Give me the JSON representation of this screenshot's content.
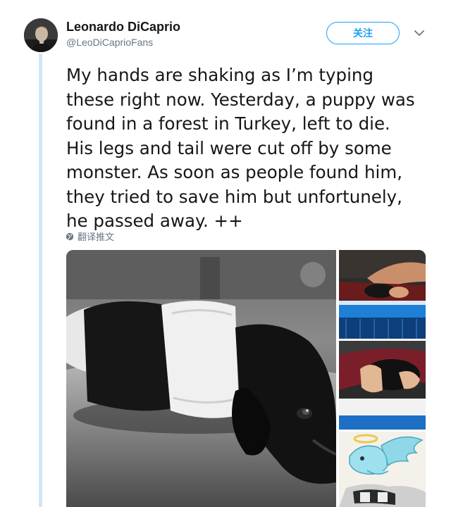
{
  "tweet": {
    "author": {
      "display_name": "Leonardo DiCaprio",
      "handle": "@LeoDiCaprioFans",
      "avatar_icon": "profile-photo"
    },
    "follow_label": "关注",
    "menu_icon": "chevron-down-icon",
    "text_lines": [
      "My hands are shaking as I’m typing",
      "these right now. Yesterday, a puppy was",
      "found in a forest in Turkey, left to die.",
      "His legs and tail were cut off by some",
      "monster. As soon as people found him,",
      "they tried to save him but unfortunely,",
      "he passed away. ++"
    ],
    "translate_label": "翻译推文",
    "translate_icon": "globe-icon",
    "media": {
      "main": "photo-puppy-bandaged",
      "side": [
        "photo-vet-table",
        "photo-puppy-blanket",
        "illustration-angel-dog"
      ]
    }
  },
  "colors": {
    "accent": "#1da1f2",
    "text": "#14171a",
    "secondary": "#657786",
    "thread_line": "#cfe6f7"
  }
}
